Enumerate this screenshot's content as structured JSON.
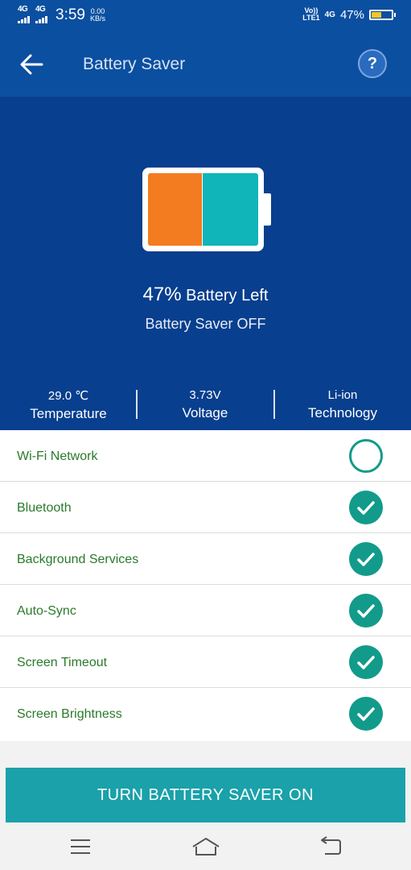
{
  "status_bar": {
    "net1": "4G",
    "net2": "4G",
    "time": "3:59",
    "speed_value": "0.00",
    "speed_unit": "KB/s",
    "volte_top": "Vo))",
    "volte_bottom": "LTE1",
    "net_right": "4G",
    "battery_percent": "47%",
    "battery_level": 0.47
  },
  "app_bar": {
    "title": "Battery Saver",
    "help_label": "?"
  },
  "hero": {
    "percent": "47%",
    "percent_suffix": "Battery Left",
    "saver_state": "Battery Saver OFF",
    "used_color": "#f47c20",
    "left_color": "#0fb5b8"
  },
  "stats": [
    {
      "value": "29.0 ℃",
      "label": "Temperature"
    },
    {
      "value": "3.73V",
      "label": "Voltage"
    },
    {
      "value": "Li-ion",
      "label": "Technology"
    }
  ],
  "settings": [
    {
      "label": "Wi-Fi Network",
      "checked": false
    },
    {
      "label": "Bluetooth",
      "checked": true
    },
    {
      "label": "Background Services",
      "checked": true
    },
    {
      "label": "Auto-Sync",
      "checked": true
    },
    {
      "label": "Screen Timeout",
      "checked": true
    },
    {
      "label": "Screen Brightness",
      "checked": true
    }
  ],
  "cta": {
    "label": "TURN BATTERY SAVER ON"
  },
  "nav": {
    "menu_icon": "menu-icon",
    "home_icon": "home-icon",
    "back_icon": "back-icon"
  },
  "colors": {
    "primary": "#0b4fa0",
    "hero": "#083f8e",
    "accent": "#129b8a",
    "cta": "#1aa1aa",
    "label_green": "#2a7a2a"
  }
}
